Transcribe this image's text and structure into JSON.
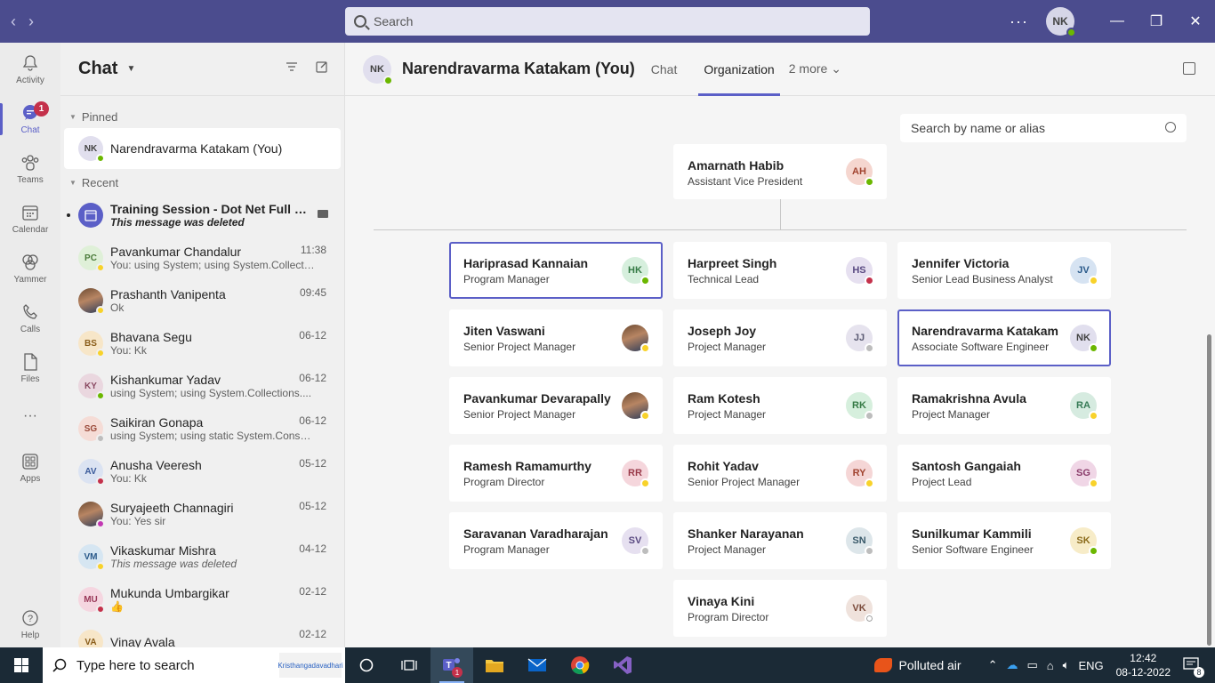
{
  "titlebar": {
    "back": "‹",
    "forward": "›",
    "search_placeholder": "Search",
    "more": "···",
    "user_initials": "NK",
    "minimize": "—",
    "maximize": "❐",
    "close": "✕"
  },
  "rail": {
    "items": [
      {
        "label": "Activity",
        "icon": "bell-icon"
      },
      {
        "label": "Chat",
        "icon": "chat-icon",
        "badge": "1"
      },
      {
        "label": "Teams",
        "icon": "teams-icon"
      },
      {
        "label": "Calendar",
        "icon": "calendar-icon"
      },
      {
        "label": "Yammer",
        "icon": "yammer-icon"
      },
      {
        "label": "Calls",
        "icon": "phone-icon"
      },
      {
        "label": "Files",
        "icon": "file-icon"
      },
      {
        "label": "···",
        "icon": "more-icon"
      },
      {
        "label": "Apps",
        "icon": "apps-icon"
      },
      {
        "label": "Help",
        "icon": "help-icon"
      }
    ]
  },
  "chat": {
    "title": "Chat",
    "pinned_label": "Pinned",
    "recent_label": "Recent",
    "pinned": {
      "name": "Narendravarma Katakam (You)",
      "initials": "NK"
    },
    "recent": [
      {
        "name": "Training Session - Dot Net Full St...",
        "msg": "This message was deleted",
        "time": "",
        "initials": "",
        "bg": "#5b5fc7",
        "fg": "#fff",
        "status": "",
        "style": "meeting"
      },
      {
        "name": "Pavankumar Chandalur",
        "msg": "You: using System; using System.Collecti...",
        "time": "11:38",
        "initials": "PC",
        "bg": "#dff0d8",
        "fg": "#4a7a3a",
        "status": "#f8d22a"
      },
      {
        "name": "Prashanth Vanipenta",
        "msg": "Ok",
        "time": "09:45",
        "initials": "",
        "bg": "photo",
        "fg": "#fff",
        "status": "#f8d22a"
      },
      {
        "name": "Bhavana Segu",
        "msg": "You: Kk",
        "time": "06-12",
        "initials": "BS",
        "bg": "#f7e6c8",
        "fg": "#8a5d1a",
        "status": "#f8d22a"
      },
      {
        "name": "Kishankumar Yadav",
        "msg": "using System; using System.Collections....",
        "time": "06-12",
        "initials": "KY",
        "bg": "#ead7df",
        "fg": "#8a4a62",
        "status": "#6bb700"
      },
      {
        "name": "Saikiran Gonapa",
        "msg": "using System; using static System.Consol...",
        "time": "06-12",
        "initials": "SG",
        "bg": "#f5dcd6",
        "fg": "#9a4a3a",
        "status": "#bdbdbd"
      },
      {
        "name": "Anusha Veeresh",
        "msg": "You: Kk",
        "time": "05-12",
        "initials": "AV",
        "bg": "#dbe3f2",
        "fg": "#3a5a9a",
        "status": "#c4314b"
      },
      {
        "name": "Suryajeeth Channagiri",
        "msg": "You: Yes sir",
        "time": "05-12",
        "initials": "",
        "bg": "photo",
        "fg": "#fff",
        "status": "#c239b3"
      },
      {
        "name": "Vikaskumar Mishra",
        "msg": "This message was deleted",
        "time": "04-12",
        "initials": "VM",
        "bg": "#d6e6f2",
        "fg": "#2a5a8a",
        "status": "#f8d22a",
        "style": "italic"
      },
      {
        "name": "Mukunda Umbargikar",
        "msg": "👍",
        "time": "02-12",
        "initials": "MU",
        "bg": "#f5d6e0",
        "fg": "#9a3a5a",
        "status": "#c4314b"
      },
      {
        "name": "Vinay Avala",
        "msg": "",
        "time": "02-12",
        "initials": "VA",
        "bg": "#f7e6c8",
        "fg": "#8a5d1a",
        "status": ""
      }
    ]
  },
  "main": {
    "name": "Narendravarma Katakam (You)",
    "initials": "NK",
    "tabs": [
      "Chat",
      "Organization",
      "2 more ⌄"
    ],
    "org_search_placeholder": "Search by name or alias"
  },
  "org": {
    "manager": {
      "name": "Amarnath Habib",
      "title": "Assistant Vice President",
      "initials": "AH",
      "bg": "#f5d6cf",
      "fg": "#a1432f",
      "status": "#6bb700"
    },
    "peers": [
      {
        "name": "Hariprasad Kannaian",
        "title": "Program Manager",
        "initials": "HK",
        "bg": "#d6efdd",
        "fg": "#357a45",
        "status": "#6bb700",
        "hl": true
      },
      {
        "name": "Harpreet Singh",
        "title": "Technical Lead",
        "initials": "HS",
        "bg": "#e6e0f0",
        "fg": "#5a4a82",
        "status": "#c4314b"
      },
      {
        "name": "Jennifer Victoria",
        "title": "Senior Lead Business Analyst",
        "initials": "JV",
        "bg": "#d6e3f2",
        "fg": "#2a5a8a",
        "status": "#f8d22a"
      },
      {
        "name": "Jiten Vaswani",
        "title": "Senior Project Manager",
        "initials": "",
        "bg": "photo",
        "fg": "#fff",
        "status": "#f8d22a"
      },
      {
        "name": "Joseph Joy",
        "title": "Project Manager",
        "initials": "JJ",
        "bg": "#e6e3ee",
        "fg": "#5a5a72",
        "status": "#bdbdbd"
      },
      {
        "name": "Narendravarma Katakam",
        "title": "Associate Software Engineer",
        "initials": "NK",
        "bg": "#e1dfee",
        "fg": "#424242",
        "status": "#6bb700",
        "hl": true
      },
      {
        "name": "Pavankumar Devarapally",
        "title": "Senior Project Manager",
        "initials": "",
        "bg": "photo",
        "fg": "#fff",
        "status": "#f8d22a"
      },
      {
        "name": "Ram Kotesh",
        "title": "Project Manager",
        "initials": "RK",
        "bg": "#d6efdd",
        "fg": "#357a45",
        "status": "#bdbdbd"
      },
      {
        "name": "Ramakrishna Avula",
        "title": "Project Manager",
        "initials": "RA",
        "bg": "#d6ebe0",
        "fg": "#357a55",
        "status": "#f8d22a"
      },
      {
        "name": "Ramesh Ramamurthy",
        "title": "Program Director",
        "initials": "RR",
        "bg": "#f5d6dc",
        "fg": "#9a3a4a",
        "status": "#f8d22a"
      },
      {
        "name": "Rohit Yadav",
        "title": "Senior Project Manager",
        "initials": "RY",
        "bg": "#f5d6d6",
        "fg": "#a1432f",
        "status": "#f8d22a"
      },
      {
        "name": "Santosh Gangaiah",
        "title": "Project Lead",
        "initials": "SG",
        "bg": "#f0d6e6",
        "fg": "#8a3a6a",
        "status": "#f8d22a"
      },
      {
        "name": "Saravanan Varadharajan",
        "title": "Program Manager",
        "initials": "SV",
        "bg": "#e6e0f0",
        "fg": "#5a4a82",
        "status": "#bdbdbd"
      },
      {
        "name": "Shanker Narayanan",
        "title": "Project Manager",
        "initials": "SN",
        "bg": "#dde6ea",
        "fg": "#3a5a6a",
        "status": "#bdbdbd"
      },
      {
        "name": "Sunilkumar Kammili",
        "title": "Senior Software Engineer",
        "initials": "SK",
        "bg": "#f7ecc8",
        "fg": "#8a6a1a",
        "status": "#6bb700"
      },
      {
        "name": "Vinaya Kini",
        "title": "Program Director",
        "initials": "VK",
        "bg": "#efe2dc",
        "fg": "#7a4a3a",
        "status": "#ffffff"
      }
    ]
  },
  "taskbar": {
    "search_placeholder": "Type here to search",
    "news_label": "Kristhangadavadhari",
    "teams_badge": "1",
    "weather": "Polluted air",
    "lang": "ENG",
    "time": "12:42",
    "date": "08-12-2022",
    "notif": "8"
  }
}
